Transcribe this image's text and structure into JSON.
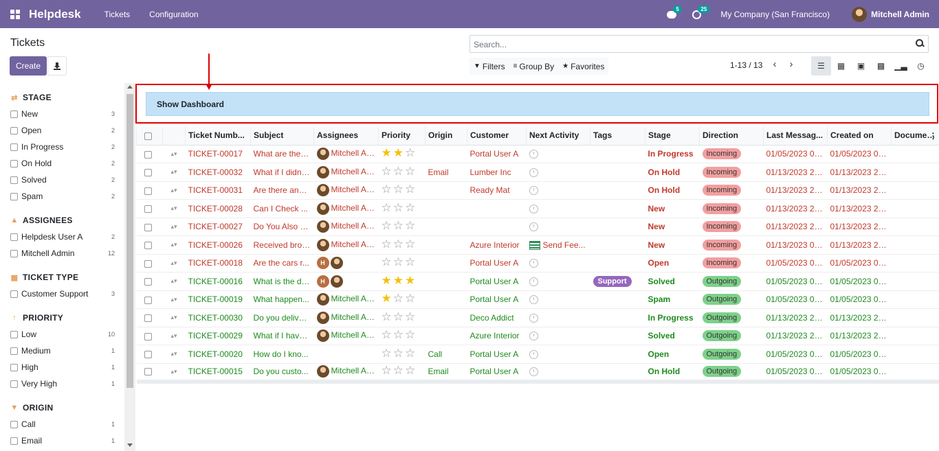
{
  "navbar": {
    "app_title": "Helpdesk",
    "menu": [
      "Tickets",
      "Configuration"
    ],
    "messages_count": "5",
    "activities_count": "25",
    "company": "My Company (San Francisco)",
    "user": "Mitchell Admin",
    "color": "#71639e"
  },
  "control": {
    "title": "Tickets",
    "create_label": "Create",
    "search_placeholder": "Search...",
    "filters_label": "Filters",
    "group_by_label": "Group By",
    "favorites_label": "Favorites",
    "pager": "1-13 / 13"
  },
  "sidebar": {
    "sections": [
      {
        "title": "STAGE",
        "icon": "refresh-icon",
        "items": [
          {
            "label": "New",
            "count": "3"
          },
          {
            "label": "Open",
            "count": "2"
          },
          {
            "label": "In Progress",
            "count": "2"
          },
          {
            "label": "On Hold",
            "count": "2"
          },
          {
            "label": "Solved",
            "count": "2"
          },
          {
            "label": "Spam",
            "count": "2"
          }
        ]
      },
      {
        "title": "ASSIGNEES",
        "icon": "user-icon",
        "items": [
          {
            "label": "Helpdesk User A",
            "count": "2"
          },
          {
            "label": "Mitchell Admin",
            "count": "12"
          }
        ]
      },
      {
        "title": "TICKET TYPE",
        "icon": "grid-icon",
        "items": [
          {
            "label": "Customer Support",
            "count": "3"
          }
        ]
      },
      {
        "title": "PRIORITY",
        "icon": "arrow-up-icon",
        "items": [
          {
            "label": "Low",
            "count": "10"
          },
          {
            "label": "Medium",
            "count": "1"
          },
          {
            "label": "High",
            "count": "1"
          },
          {
            "label": "Very High",
            "count": "1"
          }
        ]
      },
      {
        "title": "ORIGIN",
        "icon": "filter-icon",
        "items": [
          {
            "label": "Call",
            "count": "1"
          },
          {
            "label": "Email",
            "count": "1"
          }
        ]
      }
    ]
  },
  "banner": {
    "label": "Show Dashboard"
  },
  "table": {
    "columns": [
      "Ticket Numb...",
      "Subject",
      "Assignees",
      "Priority",
      "Origin",
      "Customer",
      "Next Activity",
      "Tags",
      "Stage",
      "Direction",
      "Last Messag...",
      "Created on",
      "Document ..."
    ],
    "rows": [
      {
        "color": "red",
        "number": "TICKET-00017",
        "subject": "What are the f...",
        "assignee": "Mitchell Admi",
        "assignee_type": "mitchell",
        "stars": 2,
        "origin": "",
        "customer": "Portal User A",
        "activity": "",
        "tag": "",
        "stage": "In Progress",
        "direction": "Incoming",
        "last_message": "01/05/2023 07...",
        "created": "01/05/2023 08...",
        "document": ""
      },
      {
        "color": "red",
        "number": "TICKET-00032",
        "subject": "What if I didn't...",
        "assignee": "Mitchell Admi",
        "assignee_type": "mitchell",
        "stars": 0,
        "origin": "Email",
        "customer": "Lumber Inc",
        "activity": "",
        "tag": "",
        "stage": "On Hold",
        "direction": "Incoming",
        "last_message": "01/13/2023 21...",
        "created": "01/13/2023 21...",
        "document": ""
      },
      {
        "color": "red",
        "number": "TICKET-00031",
        "subject": "Are there any ...",
        "assignee": "Mitchell Admi",
        "assignee_type": "mitchell",
        "stars": 0,
        "origin": "",
        "customer": "Ready Mat",
        "activity": "",
        "tag": "",
        "stage": "On Hold",
        "direction": "Incoming",
        "last_message": "01/13/2023 21...",
        "created": "01/13/2023 21...",
        "document": ""
      },
      {
        "color": "red",
        "number": "TICKET-00028",
        "subject": "Can I Check ...",
        "assignee": "Mitchell Admi",
        "assignee_type": "mitchell",
        "stars": 0,
        "origin": "",
        "customer": "",
        "activity": "",
        "tag": "",
        "stage": "New",
        "direction": "Incoming",
        "last_message": "01/13/2023 21...",
        "created": "01/13/2023 21...",
        "document": ""
      },
      {
        "color": "red",
        "number": "TICKET-00027",
        "subject": "Do You Also P...",
        "assignee": "Mitchell Admi",
        "assignee_type": "mitchell",
        "stars": 0,
        "origin": "",
        "customer": "",
        "activity": "",
        "tag": "",
        "stage": "New",
        "direction": "Incoming",
        "last_message": "01/13/2023 21...",
        "created": "01/13/2023 21...",
        "document": ""
      },
      {
        "color": "red",
        "number": "TICKET-00026",
        "subject": "Received brok...",
        "assignee": "Mitchell Admi",
        "assignee_type": "mitchell",
        "stars": 0,
        "origin": "",
        "customer": "Azure Interior",
        "activity": "Send Fee...",
        "tag": "",
        "stage": "New",
        "direction": "Incoming",
        "last_message": "01/13/2023 08...",
        "created": "01/13/2023 21...",
        "document": ""
      },
      {
        "color": "red",
        "number": "TICKET-00018",
        "subject": "Are the cars r...",
        "assignee": "",
        "assignee_type": "both",
        "stars": 0,
        "origin": "",
        "customer": "Portal User A",
        "activity": "",
        "tag": "",
        "stage": "Open",
        "direction": "Incoming",
        "last_message": "01/05/2023 08...",
        "created": "01/05/2023 08...",
        "document": ""
      },
      {
        "color": "green",
        "number": "TICKET-00016",
        "subject": "What is the de...",
        "assignee": "",
        "assignee_type": "both",
        "stars": 3,
        "origin": "",
        "customer": "Portal User A",
        "activity": "",
        "tag": "Support",
        "stage": "Solved",
        "direction": "Outgoing",
        "last_message": "01/05/2023 07...",
        "created": "01/05/2023 07...",
        "document": ""
      },
      {
        "color": "green",
        "number": "TICKET-00019",
        "subject": "What happen...",
        "assignee": "Mitchell Admi",
        "assignee_type": "mitchell",
        "stars": 1,
        "origin": "",
        "customer": "Portal User A",
        "activity": "",
        "tag": "",
        "stage": "Spam",
        "direction": "Outgoing",
        "last_message": "01/05/2023 08...",
        "created": "01/05/2023 08...",
        "document": ""
      },
      {
        "color": "green",
        "number": "TICKET-00030",
        "subject": "Do you deliver...",
        "assignee": "Mitchell Admi",
        "assignee_type": "mitchell",
        "stars": 0,
        "origin": "",
        "customer": "Deco Addict",
        "activity": "",
        "tag": "",
        "stage": "In Progress",
        "direction": "Outgoing",
        "last_message": "01/13/2023 21...",
        "created": "01/13/2023 21...",
        "document": ""
      },
      {
        "color": "green",
        "number": "TICKET-00029",
        "subject": "What if I have ...",
        "assignee": "Mitchell Admi",
        "assignee_type": "mitchell",
        "stars": 0,
        "origin": "",
        "customer": "Azure Interior",
        "activity": "",
        "tag": "",
        "stage": "Solved",
        "direction": "Outgoing",
        "last_message": "01/13/2023 21...",
        "created": "01/13/2023 21...",
        "document": ""
      },
      {
        "color": "green",
        "number": "TICKET-00020",
        "subject": "How do I kno...",
        "assignee": "",
        "assignee_type": "none",
        "stars": 0,
        "origin": "Call",
        "customer": "Portal User A",
        "activity": "",
        "tag": "",
        "stage": "Open",
        "direction": "Outgoing",
        "last_message": "01/05/2023 08...",
        "created": "01/05/2023 08...",
        "document": ""
      },
      {
        "color": "green",
        "number": "TICKET-00015",
        "subject": "Do you custo...",
        "assignee": "Mitchell Admi",
        "assignee_type": "mitchell",
        "stars": 0,
        "origin": "Email",
        "customer": "Portal User A",
        "activity": "",
        "tag": "",
        "stage": "On Hold",
        "direction": "Outgoing",
        "last_message": "01/05/2023 07...",
        "created": "01/05/2023 07...",
        "document": ""
      }
    ]
  }
}
